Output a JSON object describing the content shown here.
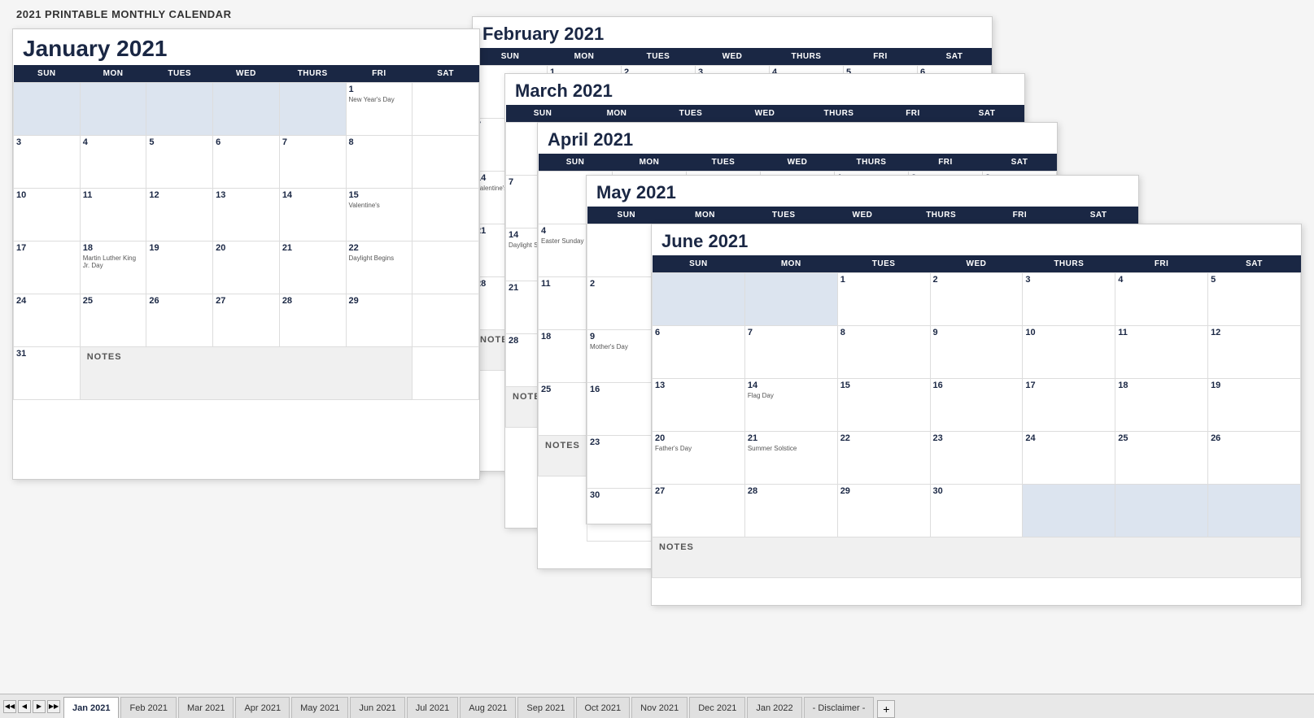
{
  "pageTitle": "2021 PRINTABLE MONTHLY CALENDAR",
  "months": {
    "january": {
      "title": "January 2021",
      "days": [
        [
          "",
          "",
          "",
          "",
          "",
          "1",
          ""
        ],
        [
          "3",
          "4",
          "5",
          "6",
          "7",
          "8",
          ""
        ],
        [
          "10",
          "11",
          "12",
          "13",
          "14",
          "15",
          ""
        ],
        [
          "17",
          "18",
          "19",
          "20",
          "21",
          "22",
          ""
        ],
        [
          "24",
          "25",
          "26",
          "27",
          "28",
          "29",
          ""
        ],
        [
          "31",
          "",
          "",
          "",
          "",
          "",
          ""
        ]
      ]
    },
    "february": {
      "title": "February 2021"
    },
    "march": {
      "title": "March 2021"
    },
    "april": {
      "title": "April 2021"
    },
    "may": {
      "title": "May 2021"
    },
    "june": {
      "title": "June 2021"
    }
  },
  "dayHeaders": [
    "SUN",
    "MON",
    "TUES",
    "WED",
    "THURS",
    "FRI",
    "SAT"
  ],
  "notes": "NOTES",
  "holidays": {
    "jan1": "New Year's Day",
    "jan18": "Martin Luther King Jr. Day",
    "feb14": "Valentine's",
    "mar14": "Daylight Begins",
    "apr4": "Easter Su...",
    "may9": "Mother's...",
    "may31": "Flag Day",
    "jun19": "Father's Day",
    "jun21": "Summer Solstice"
  },
  "tabs": [
    "Jan 2021",
    "Feb 2021",
    "Mar 2021",
    "Apr 2021",
    "May 2021",
    "Jun 2021",
    "Jul 2021",
    "Aug 2021",
    "Sep 2021",
    "Oct 2021",
    "Nov 2021",
    "Dec 2021",
    "Jan 2022",
    "- Disclaimer -"
  ],
  "activeTab": "Jan 2021"
}
